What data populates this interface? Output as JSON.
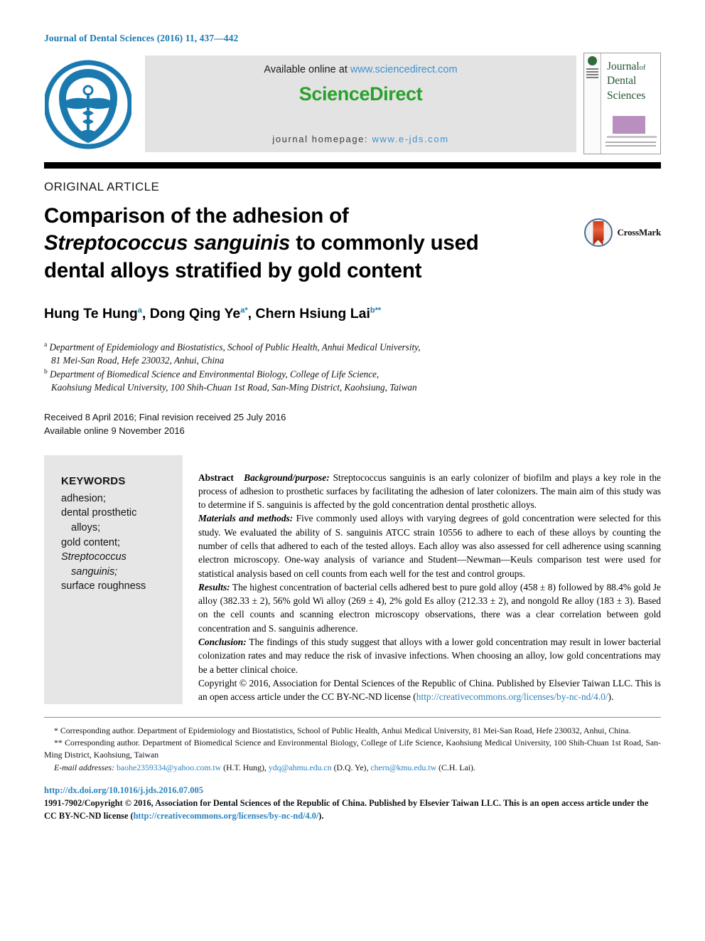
{
  "running_head": "Journal of Dental Sciences (2016) 11, 437—442",
  "masthead": {
    "society_logo_alt": "Association for Dental Sciences of the Republic of China emblem",
    "available_online_prefix": "Available online at ",
    "sciencedirect_url": "www.sciencedirect.com",
    "sciencedirect_logo": "ScienceDirect",
    "homepage_prefix": "journal homepage: ",
    "homepage_url": "www.e-jds.com",
    "cover": {
      "line1": "Journal",
      "of": "of",
      "line2": "Dental",
      "line3": "Sciences"
    }
  },
  "article": {
    "kicker": "ORIGINAL ARTICLE",
    "title_line1": "Comparison of the adhesion of",
    "title_italic": "Streptococcus sanguinis",
    "title_line2_rest": " to commonly used",
    "title_line3": "dental alloys stratified by gold content",
    "crossmark_label": "CrossMark",
    "authors": [
      {
        "name": "Hung Te Hung",
        "sup": "a",
        "sep": ", "
      },
      {
        "name": "Dong Qing Ye",
        "sup": "a*",
        "sep": ", "
      },
      {
        "name": "Chern Hsiung Lai",
        "sup": "b**",
        "sep": ""
      }
    ],
    "affiliations": [
      {
        "marker": "a",
        "line1": "Department of Epidemiology and Biostatistics, School of Public Health, Anhui Medical University,",
        "line2": "81 Mei-San Road, Hefe 230032, Anhui, China"
      },
      {
        "marker": "b",
        "line1": "Department of Biomedical Science and Environmental Biology, College of Life Science,",
        "line2": "Kaohsiung Medical University, 100 Shih-Chuan 1st Road, San-Ming District, Kaohsiung, Taiwan"
      }
    ],
    "received": "Received 8 April 2016; Final revision received 25 July 2016",
    "available_online": "Available online 9 November 2016"
  },
  "keywords": {
    "heading": "KEYWORDS",
    "items": [
      {
        "text": "adhesion;",
        "indent": false,
        "italic": false
      },
      {
        "text": "dental prosthetic",
        "indent": false,
        "italic": false
      },
      {
        "text": "alloys;",
        "indent": true,
        "italic": false
      },
      {
        "text": "gold content;",
        "indent": false,
        "italic": false
      },
      {
        "text": "Streptococcus",
        "indent": false,
        "italic": true
      },
      {
        "text": "sanguinis;",
        "indent": true,
        "italic": true
      },
      {
        "text": "surface roughness",
        "indent": false,
        "italic": false
      }
    ]
  },
  "abstract": {
    "label": "Abstract",
    "background_label": "Background/purpose:",
    "background_text": " Streptococcus sanguinis is an early colonizer of biofilm and plays a key role in the process of adhesion to prosthetic surfaces by facilitating the adhesion of later colonizers. The main aim of this study was to determine if S. sanguinis is affected by the gold concentration dental prosthetic alloys.",
    "methods_label": "Materials and methods:",
    "methods_text": " Five commonly used alloys with varying degrees of gold concentration were selected for this study. We evaluated the ability of S. sanguinis ATCC strain 10556 to adhere to each of these alloys by counting the number of cells that adhered to each of the tested alloys. Each alloy was also assessed for cell adherence using scanning electron microscopy. One-way analysis of variance and Student—Newman—Keuls comparison test were used for statistical analysis based on cell counts from each well for the test and control groups.",
    "results_label": "Results:",
    "results_text": " The highest concentration of bacterial cells adhered best to pure gold alloy (458 ± 8) followed by 88.4% gold Je alloy (382.33 ± 2), 56% gold Wi alloy (269 ± 4), 2% gold Es alloy (212.33 ± 2), and nongold Re alloy (183 ± 3). Based on the cell counts and scanning electron microscopy observations, there was a clear correlation between gold concentration and S. sanguinis adherence.",
    "conclusion_label": "Conclusion:",
    "conclusion_text": " The findings of this study suggest that alloys with a lower gold concentration may result in lower bacterial colonization rates and may reduce the risk of invasive infections. When choosing an alloy, low gold concentrations may be a better clinical choice.",
    "copyright_text": "Copyright © 2016, Association for Dental Sciences of the Republic of China. Published by Elsevier Taiwan LLC. This is an open access article under the CC BY-NC-ND license (",
    "copyright_link": "http://creativecommons.org/licenses/by-nc-nd/4.0/",
    "copyright_tail": ")."
  },
  "footnotes": {
    "corresponding_1": "* Corresponding author. Department of Epidemiology and Biostatistics, School of Public Health, Anhui Medical University, 81 Mei-San Road, Hefe 230032, Anhui, China.",
    "corresponding_2": "** Corresponding author. Department of Biomedical Science and Environmental Biology, College of Life Science, Kaohsiung Medical University, 100 Shih-Chuan 1st Road, San-Ming District, Kaohsiung, Taiwan",
    "email_label": "E-mail addresses:",
    "emails": [
      {
        "address": "baohe2359334@yahoo.com.tw",
        "owner": " (H.T. Hung), "
      },
      {
        "address": "ydq@ahmu.edu.cn",
        "owner": " (D.Q. Ye), "
      },
      {
        "address": "chern@kmu.edu.tw",
        "owner": " (C.H. Lai)."
      }
    ]
  },
  "footer": {
    "doi": "http://dx.doi.org/10.1016/j.jds.2016.07.005",
    "issn_copyright": "1991-7902/Copyright © 2016, Association for Dental Sciences of the Republic of China. Published by Elsevier Taiwan LLC. This is an open access article under the CC BY-NC-ND license (",
    "license_link": "http://creativecommons.org/licenses/by-nc-nd/4.0/",
    "license_tail": ")."
  },
  "colors": {
    "link": "#2b83bf",
    "running_head": "#1a7ab0",
    "sciencedirect_green": "#2aa02a",
    "cover_green": "#25542f",
    "keyword_bg": "#e6e6e6"
  }
}
